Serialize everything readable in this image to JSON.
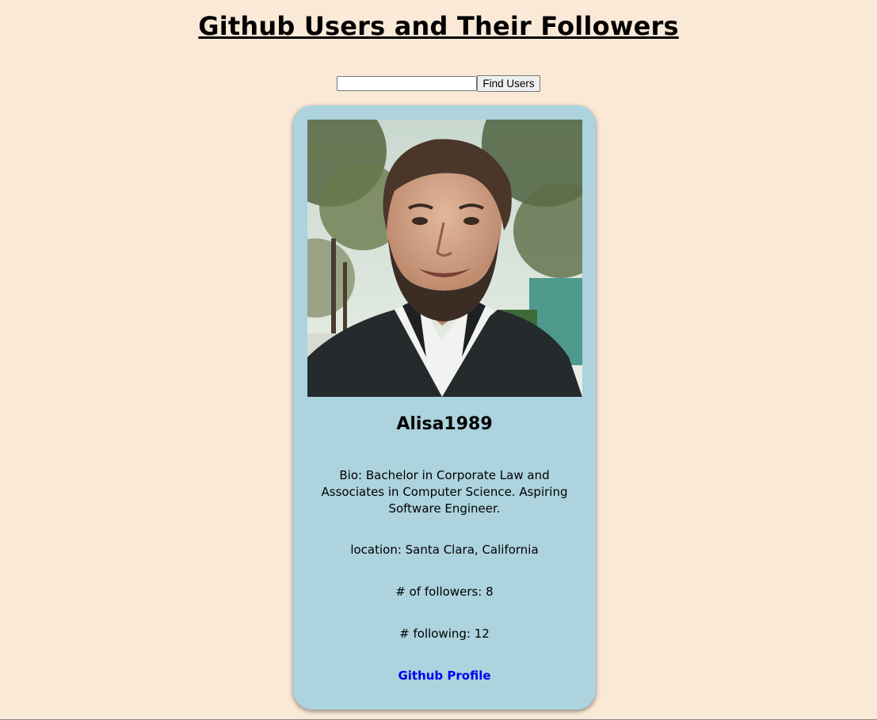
{
  "page": {
    "title": "Github Users and Their Followers"
  },
  "search": {
    "value": "",
    "placeholder": "",
    "button_label": "Find Users"
  },
  "user": {
    "username": "Alisa1989",
    "bio": "Bio: Bachelor in Corporate Law and Associates in Computer Science. Aspiring Software Engineer.",
    "location": "location: Santa Clara, California",
    "followers": "# of followers: 8",
    "following": "# following: 12",
    "profile_link_label": "Github Profile",
    "avatar_icon": "user-avatar-photo"
  },
  "colors": {
    "background": "#fae9d6",
    "card": "#acd3de",
    "link": "#0000ee"
  }
}
